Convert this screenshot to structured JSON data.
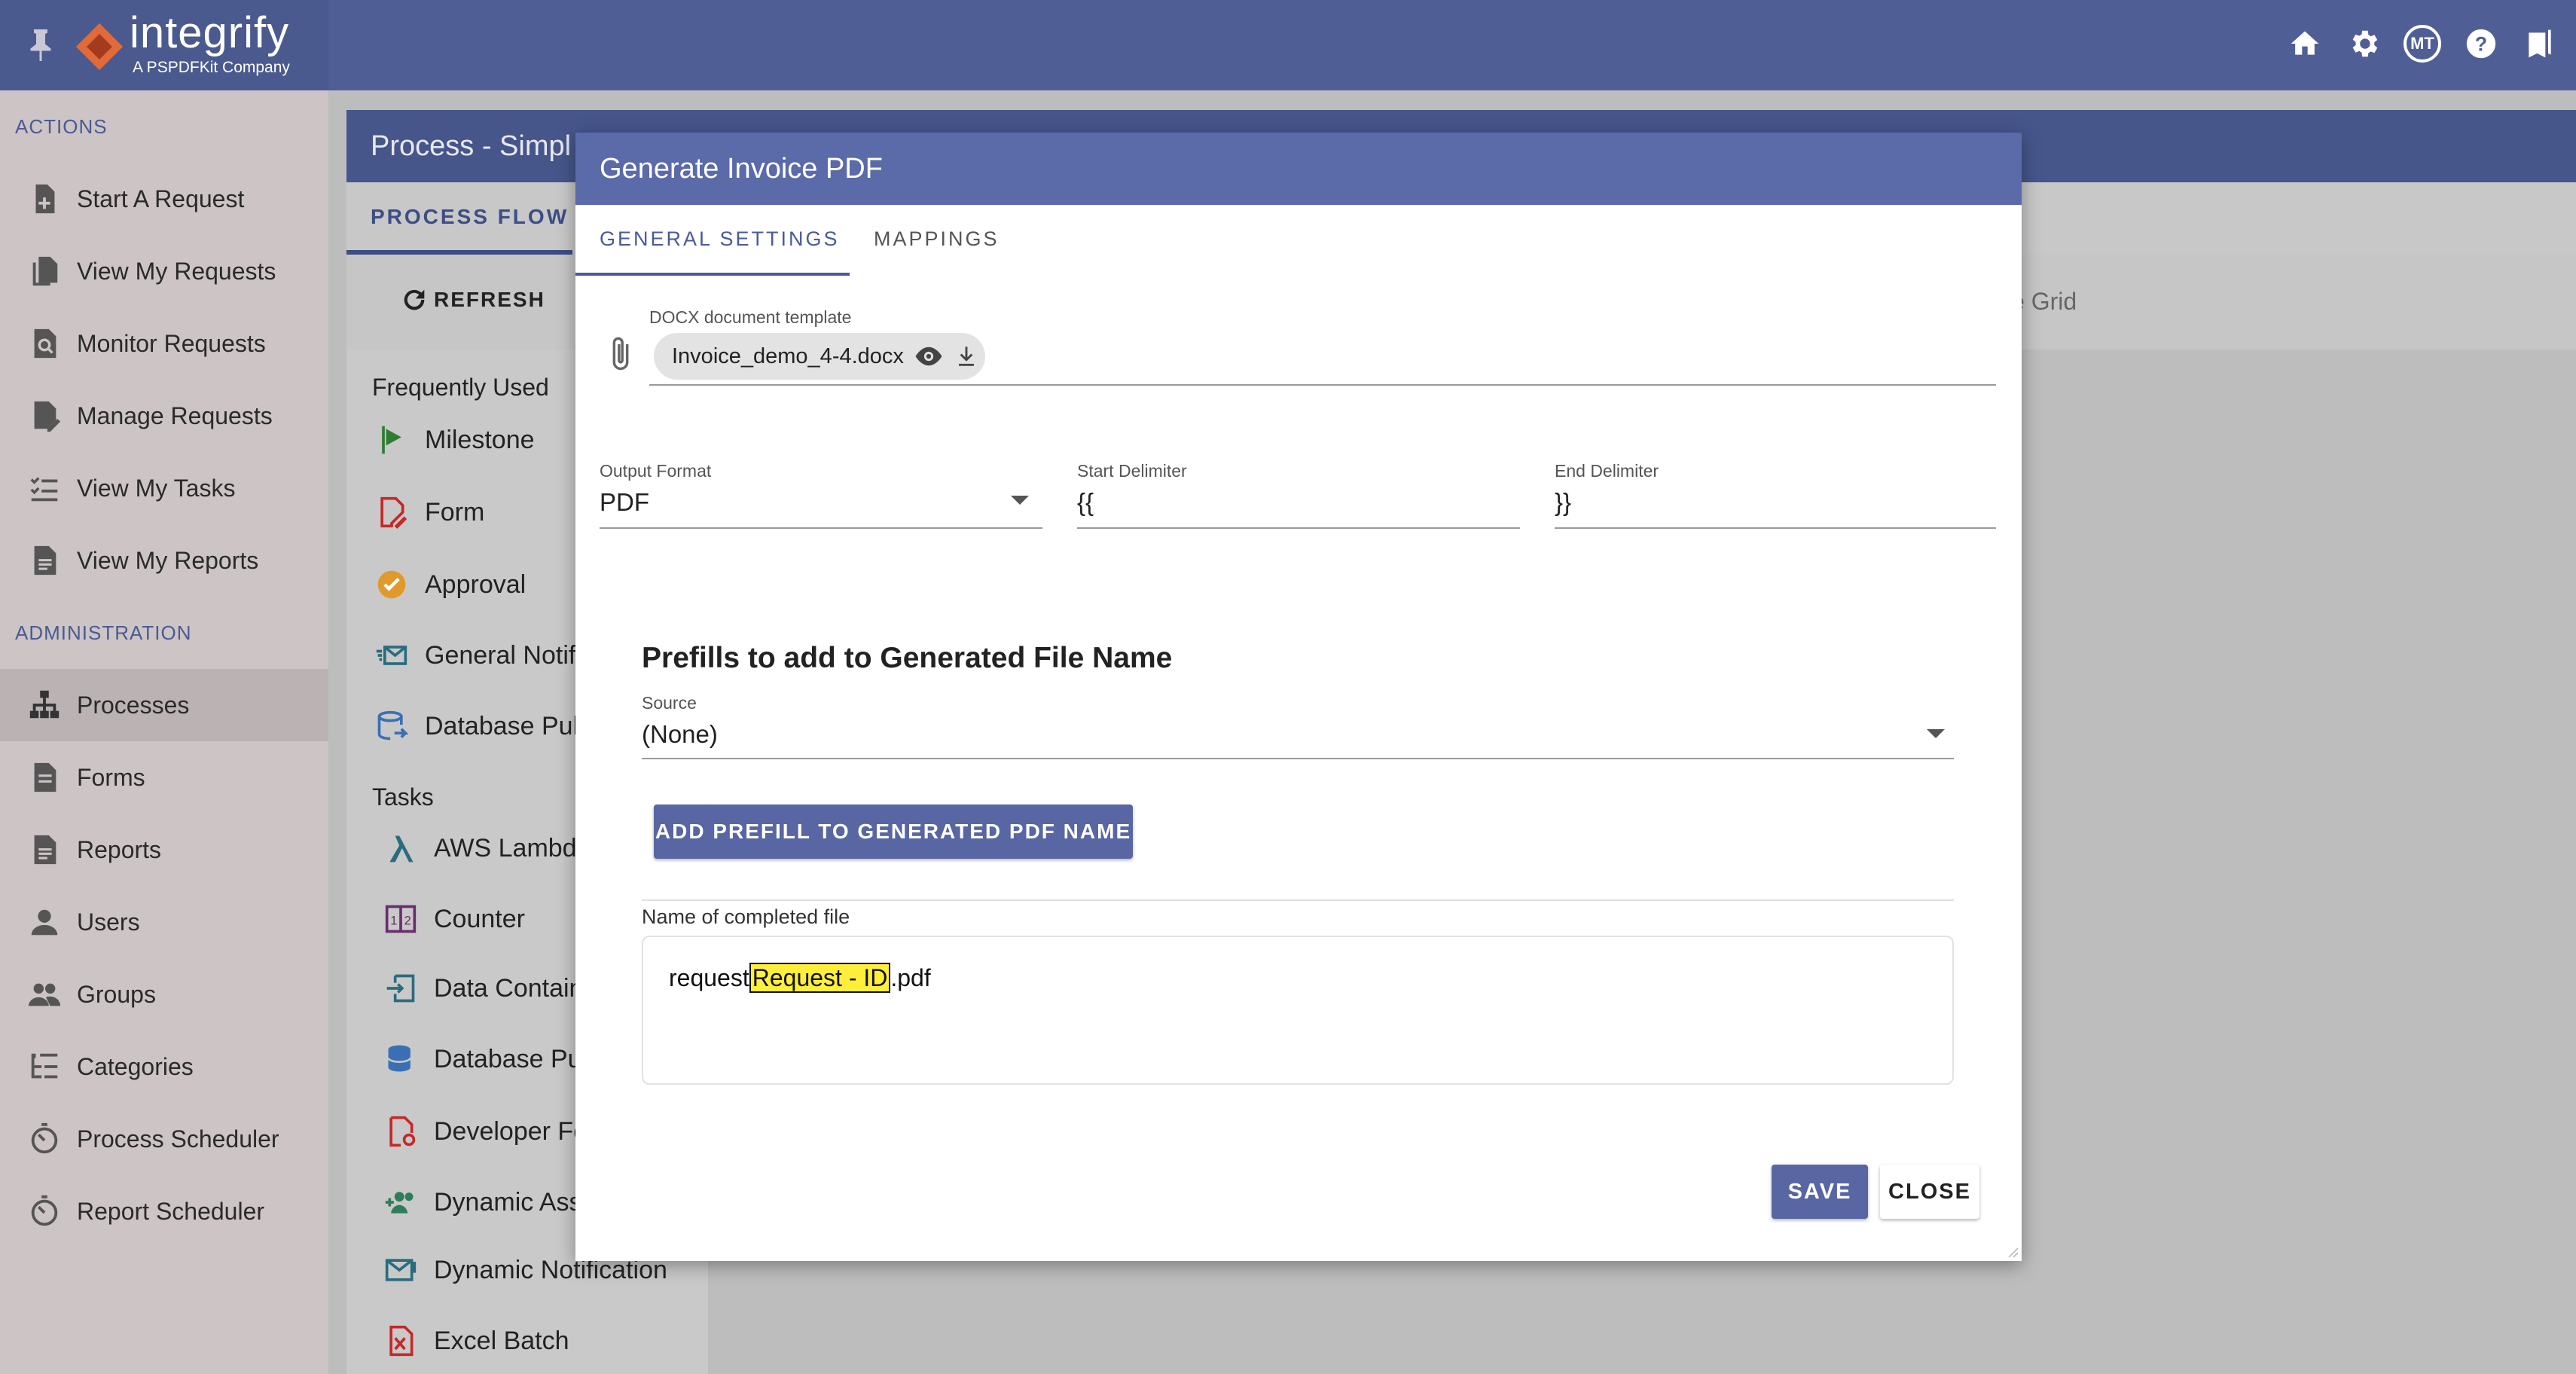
{
  "header": {
    "logo_text": "integrify",
    "logo_subtitle": "A PSPDFKit Company",
    "avatar_initials": "MT"
  },
  "sidebar": {
    "actions_heading": "ACTIONS",
    "actions": [
      {
        "label": "Start A Request",
        "icon": "file-plus-icon"
      },
      {
        "label": "View My Requests",
        "icon": "files-icon"
      },
      {
        "label": "Monitor Requests",
        "icon": "file-search-icon"
      },
      {
        "label": "Manage Requests",
        "icon": "file-edit-icon"
      },
      {
        "label": "View My Tasks",
        "icon": "checklist-icon"
      },
      {
        "label": "View My Reports",
        "icon": "report-icon"
      }
    ],
    "admin_heading": "ADMINISTRATION",
    "admin": [
      {
        "label": "Processes",
        "icon": "sitemap-icon",
        "active": true
      },
      {
        "label": "Forms",
        "icon": "form-icon"
      },
      {
        "label": "Reports",
        "icon": "report-icon"
      },
      {
        "label": "Users",
        "icon": "user-icon"
      },
      {
        "label": "Groups",
        "icon": "group-icon"
      },
      {
        "label": "Categories",
        "icon": "categories-icon"
      },
      {
        "label": "Process Scheduler",
        "icon": "timer-icon"
      },
      {
        "label": "Report Scheduler",
        "icon": "timer-icon"
      }
    ]
  },
  "background": {
    "panel_title": "Process - Simpl",
    "tab_process_flow": "PROCESS FLOW",
    "refresh_label": "REFRESH",
    "grid_text": "e Grid",
    "frequently_used_heading": "Frequently Used",
    "frequently_used": [
      "Milestone",
      "Form",
      "Approval",
      "General Notif",
      "Database Pul"
    ],
    "tasks_heading": "Tasks",
    "tasks": [
      "AWS Lambda",
      "Counter",
      "Data Contain",
      "Database Pu",
      "Developer Fo",
      "Dynamic Ass",
      "Dynamic Notification",
      "Excel Batch"
    ]
  },
  "modal": {
    "title": "Generate Invoice PDF",
    "tabs": [
      "GENERAL SETTINGS",
      "MAPPINGS"
    ],
    "template_label": "DOCX document template",
    "template_file": "Invoice_demo_4-4.docx",
    "output_format_label": "Output Format",
    "output_format_value": "PDF",
    "start_delimiter_label": "Start Delimiter",
    "start_delimiter_value": "{{",
    "end_delimiter_label": "End Delimiter",
    "end_delimiter_value": "}}",
    "prefills_title": "Prefills to add to Generated File Name",
    "source_label": "Source",
    "source_value": "(None)",
    "add_prefill_label": "ADD PREFILL TO GENERATED PDF NAME",
    "file_name_label": "Name of completed file",
    "file_name_prefix": "request",
    "file_name_token": "Request - ID",
    "file_name_suffix": ".pdf",
    "save_label": "SAVE",
    "close_label": "CLOSE"
  }
}
